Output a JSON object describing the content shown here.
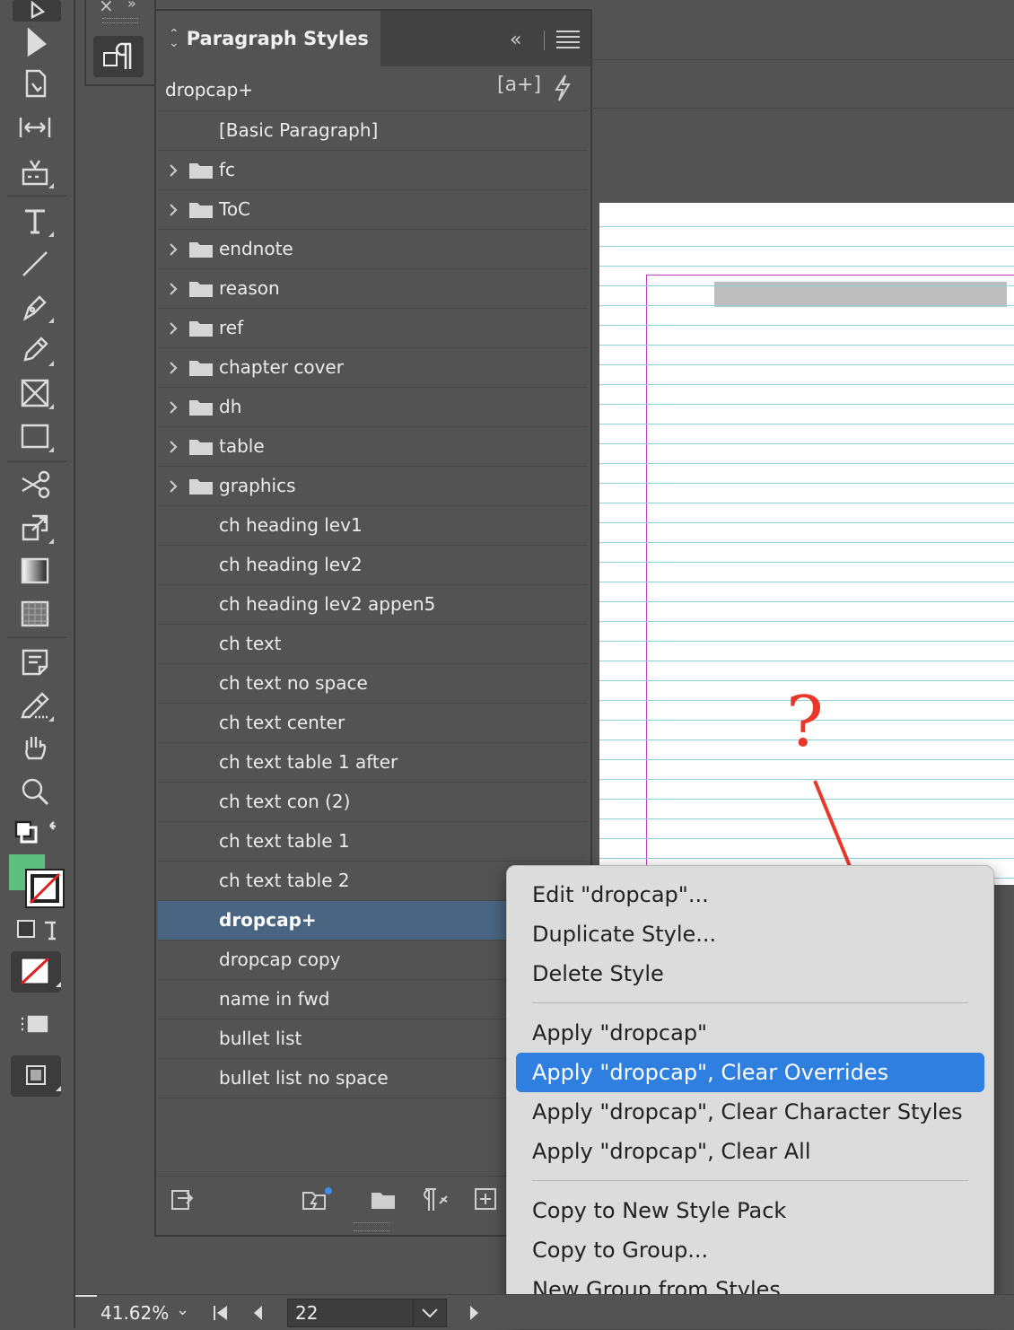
{
  "panel": {
    "title": "Paragraph Styles",
    "current_style": "dropcap+",
    "styles": [
      {
        "label": "[Basic Paragraph]",
        "type": "style"
      },
      {
        "label": "fc",
        "type": "group"
      },
      {
        "label": "ToC",
        "type": "group"
      },
      {
        "label": "endnote",
        "type": "group"
      },
      {
        "label": "reason",
        "type": "group"
      },
      {
        "label": "ref",
        "type": "group"
      },
      {
        "label": "chapter cover",
        "type": "group"
      },
      {
        "label": "dh",
        "type": "group"
      },
      {
        "label": "table",
        "type": "group"
      },
      {
        "label": "graphics",
        "type": "group"
      },
      {
        "label": "ch heading lev1",
        "type": "style"
      },
      {
        "label": "ch heading lev2",
        "type": "style"
      },
      {
        "label": "ch heading lev2 appen5",
        "type": "style"
      },
      {
        "label": "ch text",
        "type": "style"
      },
      {
        "label": "ch text no space",
        "type": "style"
      },
      {
        "label": "ch text center",
        "type": "style"
      },
      {
        "label": "ch text table 1 after",
        "type": "style"
      },
      {
        "label": "ch text con (2)",
        "type": "style"
      },
      {
        "label": "ch text table 1",
        "type": "style"
      },
      {
        "label": "ch text table 2",
        "type": "style"
      },
      {
        "label": "dropcap+",
        "type": "style",
        "selected": true
      },
      {
        "label": "dropcap copy",
        "type": "style"
      },
      {
        "label": "name in fwd",
        "type": "style"
      },
      {
        "label": "bullet list",
        "type": "style"
      },
      {
        "label": "bullet list no space",
        "type": "style"
      }
    ]
  },
  "context_menu": {
    "items": [
      {
        "label": "Edit \"dropcap\"..."
      },
      {
        "label": "Duplicate Style..."
      },
      {
        "label": "Delete Style"
      },
      {
        "label": "Apply \"dropcap\""
      },
      {
        "label": "Apply \"dropcap\", Clear Overrides",
        "highlighted": true
      },
      {
        "label": "Apply \"dropcap\", Clear Character Styles"
      },
      {
        "label": "Apply \"dropcap\", Clear All"
      },
      {
        "label": "Copy to New Style Pack"
      },
      {
        "label": "Copy to Group..."
      },
      {
        "label": "New Group from Styles..."
      }
    ]
  },
  "annotation": {
    "mark": "?",
    "color": "#e8382c"
  },
  "statusbar": {
    "zoom": "41.62%",
    "page": "22"
  },
  "colors": {
    "selection": "#4a6582",
    "menu_highlight": "#2f7fe0",
    "fill_swatch": "#5fbf7f"
  }
}
